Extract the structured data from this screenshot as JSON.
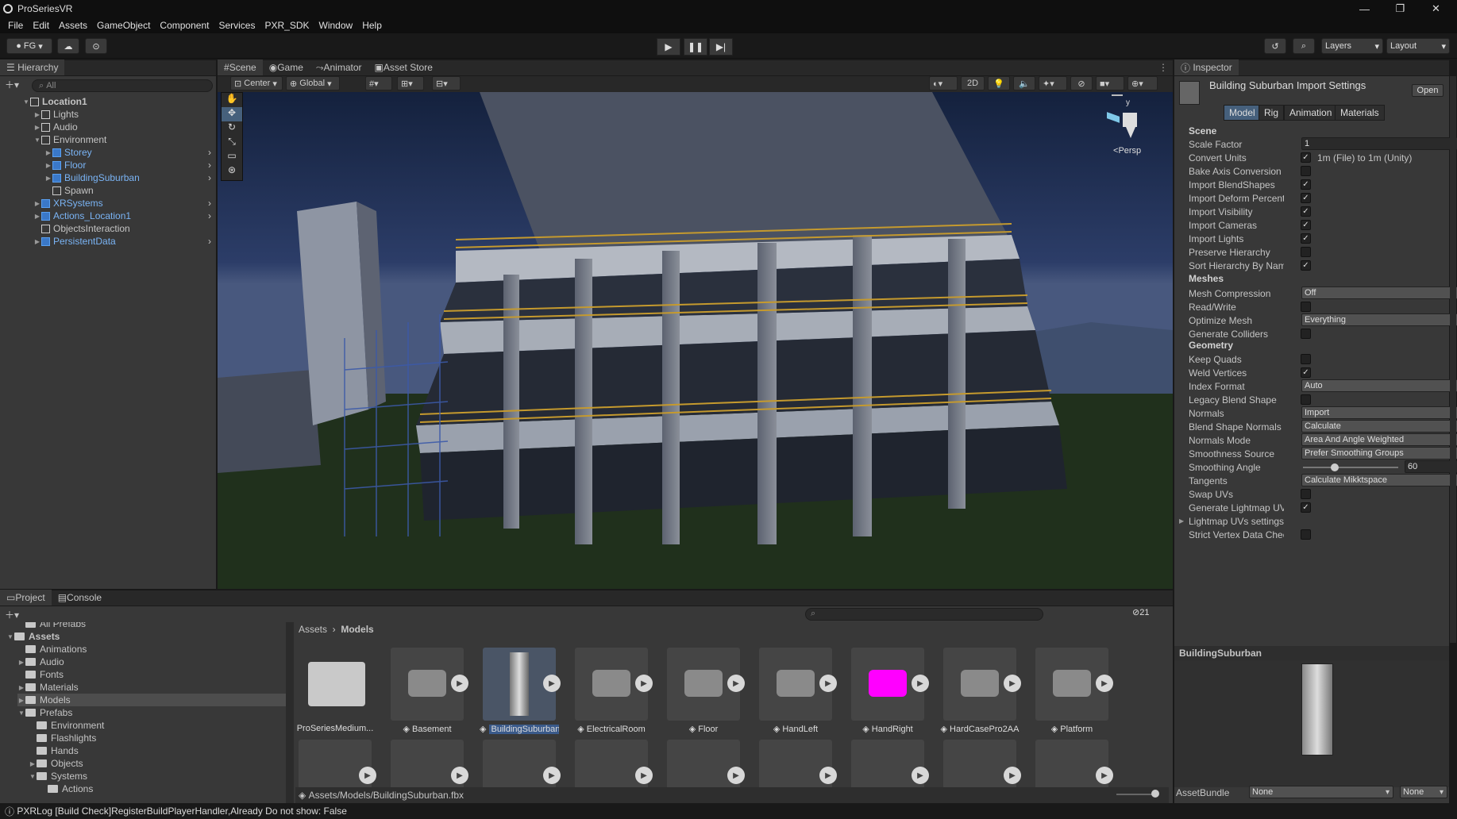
{
  "window": {
    "title": "ProSeriesVR"
  },
  "menu": [
    "File",
    "Edit",
    "Assets",
    "GameObject",
    "Component",
    "Services",
    "PXR_SDK",
    "Window",
    "Help"
  ],
  "toolbar": {
    "account": "FG",
    "layers": "Layers",
    "layout": "Layout"
  },
  "hierarchy": {
    "tab": "Hierarchy",
    "search_placeholder": "All",
    "items": [
      {
        "label": "Location1",
        "depth": 0,
        "prefab": false,
        "open": true
      },
      {
        "label": "Lights",
        "depth": 1,
        "prefab": false
      },
      {
        "label": "Audio",
        "depth": 1,
        "prefab": false
      },
      {
        "label": "Environment",
        "depth": 1,
        "prefab": false,
        "open": true
      },
      {
        "label": "Storey",
        "depth": 2,
        "prefab": true
      },
      {
        "label": "Floor",
        "depth": 2,
        "prefab": true
      },
      {
        "label": "BuildingSuburban",
        "depth": 2,
        "prefab": true
      },
      {
        "label": "Spawn",
        "depth": 2,
        "prefab": false
      },
      {
        "label": "XRSystems",
        "depth": 1,
        "prefab": true
      },
      {
        "label": "Actions_Location1",
        "depth": 1,
        "prefab": true
      },
      {
        "label": "ObjectsInteraction",
        "depth": 1,
        "prefab": false
      },
      {
        "label": "PersistentData",
        "depth": 1,
        "prefab": true
      }
    ]
  },
  "scene_tabs": [
    "Scene",
    "Game",
    "Animator",
    "Asset Store"
  ],
  "scene_toolbar": {
    "pivot": "Center",
    "space": "Global",
    "mode2d": "2D"
  },
  "gizmo": {
    "axis_y": "y",
    "view": "Persp"
  },
  "inspector": {
    "tab": "Inspector",
    "title": "Building Suburban Import Settings",
    "open_button": "Open",
    "tabs": [
      "Model",
      "Rig",
      "Animation",
      "Materials"
    ],
    "scene_section": "Scene",
    "scale_factor_label": "Scale Factor",
    "scale_factor": "1",
    "convert_units_label": "Convert Units",
    "convert_units_text": "1m (File) to 1m (Unity)",
    "checks": [
      {
        "label": "Bake Axis Conversion",
        "checked": false
      },
      {
        "label": "Import BlendShapes",
        "checked": true
      },
      {
        "label": "Import Deform Percent",
        "checked": true
      },
      {
        "label": "Import Visibility",
        "checked": true
      },
      {
        "label": "Import Cameras",
        "checked": true
      },
      {
        "label": "Import Lights",
        "checked": true
      },
      {
        "label": "Preserve Hierarchy",
        "checked": false
      },
      {
        "label": "Sort Hierarchy By Name",
        "checked": true
      }
    ],
    "meshes_section": "Meshes",
    "mesh_compression_label": "Mesh Compression",
    "mesh_compression": "Off",
    "read_write_label": "Read/Write",
    "optimize_mesh_label": "Optimize Mesh",
    "optimize_mesh": "Everything",
    "generate_colliders_label": "Generate Colliders",
    "geometry_section": "Geometry",
    "keep_quads_label": "Keep Quads",
    "weld_vertices_label": "Weld Vertices",
    "index_format_label": "Index Format",
    "index_format": "Auto",
    "legacy_blend_label": "Legacy Blend Shape",
    "normals_label": "Normals",
    "normals": "Import",
    "blend_normals_label": "Blend Shape Normals",
    "blend_normals": "Calculate",
    "normals_mode_label": "Normals Mode",
    "normals_mode": "Area And Angle Weighted",
    "smoothness_label": "Smoothness Source",
    "smoothness": "Prefer Smoothing Groups",
    "smoothing_angle_label": "Smoothing Angle",
    "smoothing_angle": "60",
    "smoothing_angle_fraction": 0.33,
    "tangents_label": "Tangents",
    "tangents": "Calculate Mikktspace",
    "swap_uvs_label": "Swap UVs",
    "gen_lightmap_label": "Generate Lightmap UVs",
    "lightmap_settings_label": "Lightmap UVs settings",
    "strict_vertex_label": "Strict Vertex Data Checks",
    "preview_title": "BuildingSuburban",
    "assetbundle_label": "AssetBundle",
    "assetbundle": "None",
    "assetbundle_variant": "None"
  },
  "project": {
    "tabs": [
      "Project",
      "Console"
    ],
    "hidden_count": "21",
    "breadcrumb": [
      "Assets",
      "Models"
    ],
    "tree": [
      {
        "label": "All Prefabs",
        "depth": 1
      },
      {
        "label": "Assets",
        "depth": 0,
        "bold": true
      },
      {
        "label": "Animations",
        "depth": 1
      },
      {
        "label": "Audio",
        "depth": 1
      },
      {
        "label": "Fonts",
        "depth": 1
      },
      {
        "label": "Materials",
        "depth": 1
      },
      {
        "label": "Models",
        "depth": 1,
        "selected": true
      },
      {
        "label": "Prefabs",
        "depth": 1
      },
      {
        "label": "Environment",
        "depth": 2
      },
      {
        "label": "Flashlights",
        "depth": 2
      },
      {
        "label": "Hands",
        "depth": 2
      },
      {
        "label": "Objects",
        "depth": 2
      },
      {
        "label": "Systems",
        "depth": 2
      },
      {
        "label": "Actions",
        "depth": 3
      }
    ],
    "assets": [
      {
        "label": "ProSeriesMedium...",
        "kind": "folder"
      },
      {
        "label": "Basement",
        "kind": "model"
      },
      {
        "label": "BuildingSuburban",
        "kind": "model",
        "selected": true
      },
      {
        "label": "ElectricalRoom",
        "kind": "model"
      },
      {
        "label": "Floor",
        "kind": "model"
      },
      {
        "label": "HandLeft",
        "kind": "model"
      },
      {
        "label": "HandRight",
        "kind": "model",
        "color": "#ff00ff"
      },
      {
        "label": "HardCasePro2AA",
        "kind": "model"
      },
      {
        "label": "Platform",
        "kind": "model"
      }
    ],
    "path": "Assets/Models/BuildingSuburban.fbx"
  },
  "status": {
    "message": "PXRLog [Build Check]RegisterBuildPlayerHandler,Already Do not show: False"
  }
}
